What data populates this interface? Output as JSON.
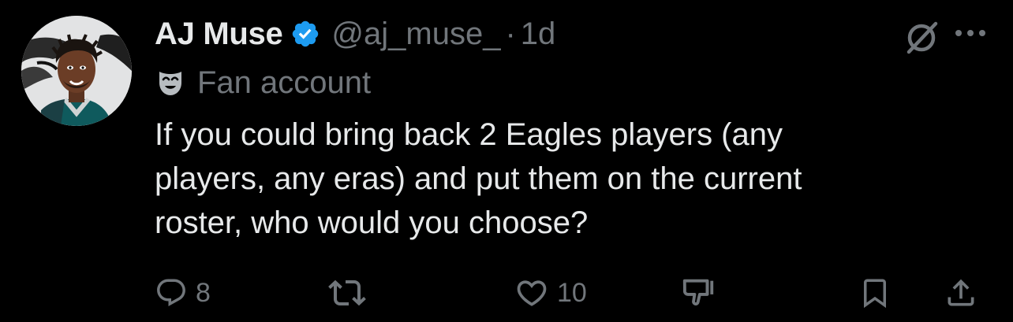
{
  "author": {
    "display_name": "AJ Muse",
    "handle": "@aj_muse_",
    "separator": "·",
    "time": "1d",
    "label": "Fan account",
    "verified": true
  },
  "tweet": {
    "lines": [
      "If you could bring back 2 Eagles players (any",
      "players, any eras) and put them on the current",
      "roster, who would you choose?"
    ]
  },
  "actions": {
    "reply": {
      "icon": "reply-icon",
      "count": "8"
    },
    "repost": {
      "icon": "repost-icon",
      "count": ""
    },
    "like": {
      "icon": "heart-icon",
      "count": "10"
    },
    "dislike": {
      "icon": "downvote-icon"
    },
    "bookmark": {
      "icon": "bookmark-icon"
    },
    "share": {
      "icon": "share-icon"
    }
  },
  "colors": {
    "background": "#000000",
    "primary_text": "#e7e9ea",
    "secondary_text": "#71767b",
    "verified_blue": "#1d9bf0"
  }
}
